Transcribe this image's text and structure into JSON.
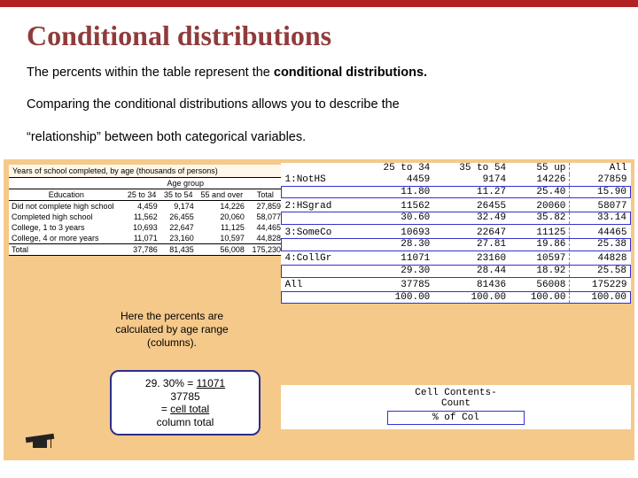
{
  "title": "Conditional distributions",
  "para1a": "The percents within the table represent the ",
  "para1b": "conditional distributions.",
  "para2": "Comparing the conditional distributions allows you to describe the",
  "para3": "“relationship” between both categorical variables.",
  "leftTable": {
    "caption": "Years of school completed, by age (thousands of persons)",
    "groupHeader": "Age group",
    "rowHead": "Education",
    "cols": [
      "25 to 34",
      "35 to 54",
      "55 and over",
      "Total"
    ],
    "rows": [
      {
        "label": "Did not complete high school",
        "v": [
          "4,459",
          "9,174",
          "14,226",
          "27,859"
        ]
      },
      {
        "label": "Completed high school",
        "v": [
          "11,562",
          "26,455",
          "20,060",
          "58,077"
        ]
      },
      {
        "label": "College, 1 to 3 years",
        "v": [
          "10,693",
          "22,647",
          "11,125",
          "44,465"
        ]
      },
      {
        "label": "College, 4 or more years",
        "v": [
          "11,071",
          "23,160",
          "10,597",
          "44,828"
        ]
      }
    ],
    "total": {
      "label": "Total",
      "v": [
        "37,786",
        "81,435",
        "56,008",
        "175,230"
      ]
    }
  },
  "rightTable": {
    "head": [
      "",
      "25 to 34",
      "35 to 54",
      "55 up",
      "All"
    ],
    "groups": [
      {
        "label": "1:NotHS",
        "count": [
          "4459",
          "9174",
          "14226",
          "27859"
        ],
        "pct": [
          "11.80",
          "11.27",
          "25.40",
          "15.90"
        ]
      },
      {
        "label": "2:HSgrad",
        "count": [
          "11562",
          "26455",
          "20060",
          "58077"
        ],
        "pct": [
          "30.60",
          "32.49",
          "35.82",
          "33.14"
        ]
      },
      {
        "label": "3:SomeCo",
        "count": [
          "10693",
          "22647",
          "11125",
          "44465"
        ],
        "pct": [
          "28.30",
          "27.81",
          "19.86",
          "25.38"
        ]
      },
      {
        "label": "4:CollGr",
        "count": [
          "11071",
          "23160",
          "10597",
          "44828"
        ],
        "pct": [
          "29.30",
          "28.44",
          "18.92",
          "25.58"
        ]
      },
      {
        "label": "All",
        "count": [
          "37785",
          "81436",
          "56008",
          "175229"
        ],
        "pct": [
          "100.00",
          "100.00",
          "100.00",
          "100.00"
        ]
      }
    ],
    "contents1": "Cell Contents-",
    "contents2": "Count",
    "contents3": "% of Col"
  },
  "callout1": "Here the percents are calculated by age range (columns).",
  "callout2": {
    "line1a": "29. 30% =  ",
    "line1b": "11071",
    "line2": "37785",
    "line3a": "=   ",
    "line3b": "cell total",
    "line4": "column total"
  }
}
